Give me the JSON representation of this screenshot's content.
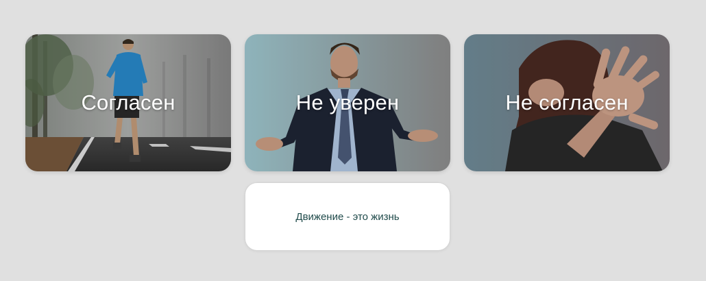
{
  "cards": [
    {
      "label": "Согласен",
      "image": "runner-on-foggy-road"
    },
    {
      "label": "Не уверен",
      "image": "man-in-suit-shrugging"
    },
    {
      "label": "Не согласен",
      "image": "woman-raising-hand-stop"
    }
  ],
  "statement": {
    "text": "Движение - это жизнь"
  },
  "colors": {
    "background": "#e0e0e0",
    "card_text": "#ffffff",
    "statement_text": "#1f4a4a",
    "statement_bg": "#ffffff"
  }
}
